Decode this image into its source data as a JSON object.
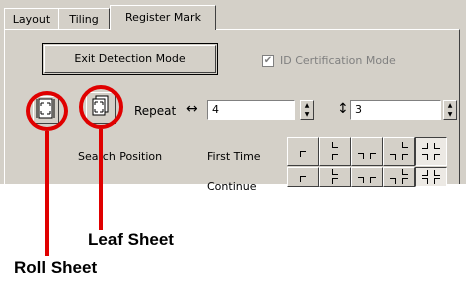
{
  "tabs": [
    {
      "label": "Layout"
    },
    {
      "label": "Tiling"
    },
    {
      "label": "Register Mark",
      "active": true
    }
  ],
  "exit_button": "Exit Detection Mode",
  "id_cert": {
    "label": "ID Certification Mode",
    "checked": true,
    "disabled": true
  },
  "repeat": {
    "label": "Repeat",
    "h_symbol": "↔",
    "h_value": "4",
    "v_symbol": "↕",
    "v_value": "3"
  },
  "search_position": {
    "label": "Search Position",
    "first_time": "First Time",
    "continue": "Continue"
  },
  "callouts": {
    "leaf_sheet": "Leaf Sheet",
    "roll_sheet": "Roll Sheet"
  },
  "colors": {
    "dialog_bg": "#d4d0c8",
    "highlight": "#e00000"
  }
}
